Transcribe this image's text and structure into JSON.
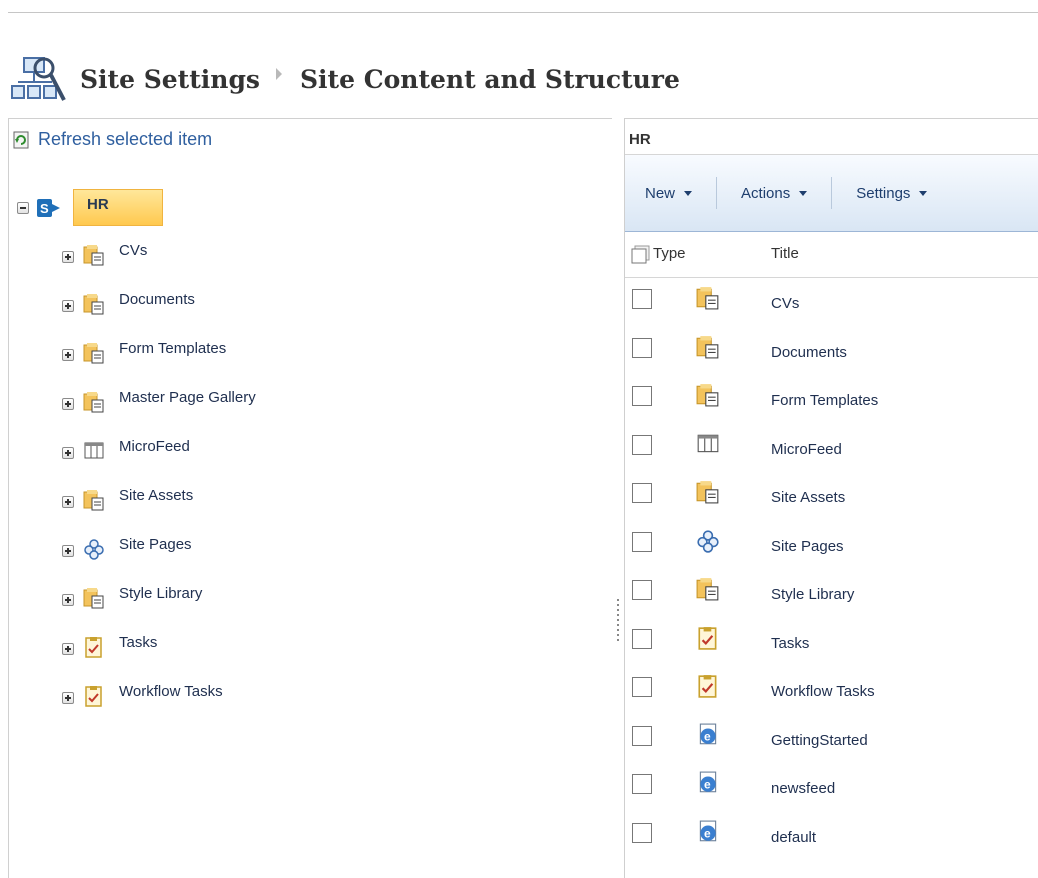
{
  "header": {
    "crumbs": [
      "Site Settings",
      "Site Content and Structure"
    ]
  },
  "left": {
    "refresh_label": "Refresh selected item",
    "root_label": "HR",
    "items": [
      {
        "label": "CVs",
        "icon": "folder-document-icon"
      },
      {
        "label": "Documents",
        "icon": "folder-document-icon"
      },
      {
        "label": "Form Templates",
        "icon": "folder-document-icon"
      },
      {
        "label": "Master Page Gallery",
        "icon": "folder-document-icon"
      },
      {
        "label": "MicroFeed",
        "icon": "list-icon"
      },
      {
        "label": "Site Assets",
        "icon": "folder-document-icon"
      },
      {
        "label": "Site Pages",
        "icon": "site-pages-icon"
      },
      {
        "label": "Style Library",
        "icon": "folder-document-icon"
      },
      {
        "label": "Tasks",
        "icon": "tasks-icon"
      },
      {
        "label": "Workflow Tasks",
        "icon": "tasks-icon"
      }
    ]
  },
  "right": {
    "title": "HR",
    "toolbar": {
      "new": "New",
      "actions": "Actions",
      "settings": "Settings"
    },
    "columns": {
      "type": "Type",
      "title": "Title"
    },
    "rows": [
      {
        "title": "CVs",
        "icon": "folder-document-icon"
      },
      {
        "title": "Documents",
        "icon": "folder-document-icon"
      },
      {
        "title": "Form Templates",
        "icon": "folder-document-icon"
      },
      {
        "title": "MicroFeed",
        "icon": "list-icon"
      },
      {
        "title": "Site Assets",
        "icon": "folder-document-icon"
      },
      {
        "title": "Site Pages",
        "icon": "site-pages-icon"
      },
      {
        "title": "Style Library",
        "icon": "folder-document-icon"
      },
      {
        "title": "Tasks",
        "icon": "tasks-icon"
      },
      {
        "title": "Workflow Tasks",
        "icon": "tasks-icon"
      },
      {
        "title": "GettingStarted",
        "icon": "web-page-icon"
      },
      {
        "title": "newsfeed",
        "icon": "web-page-icon"
      },
      {
        "title": "default",
        "icon": "web-page-icon"
      }
    ]
  },
  "colors": {
    "link": "#2f5f9f",
    "selected_bg": "#ffd76a",
    "toolbar_blue": "#1e3e6e"
  }
}
